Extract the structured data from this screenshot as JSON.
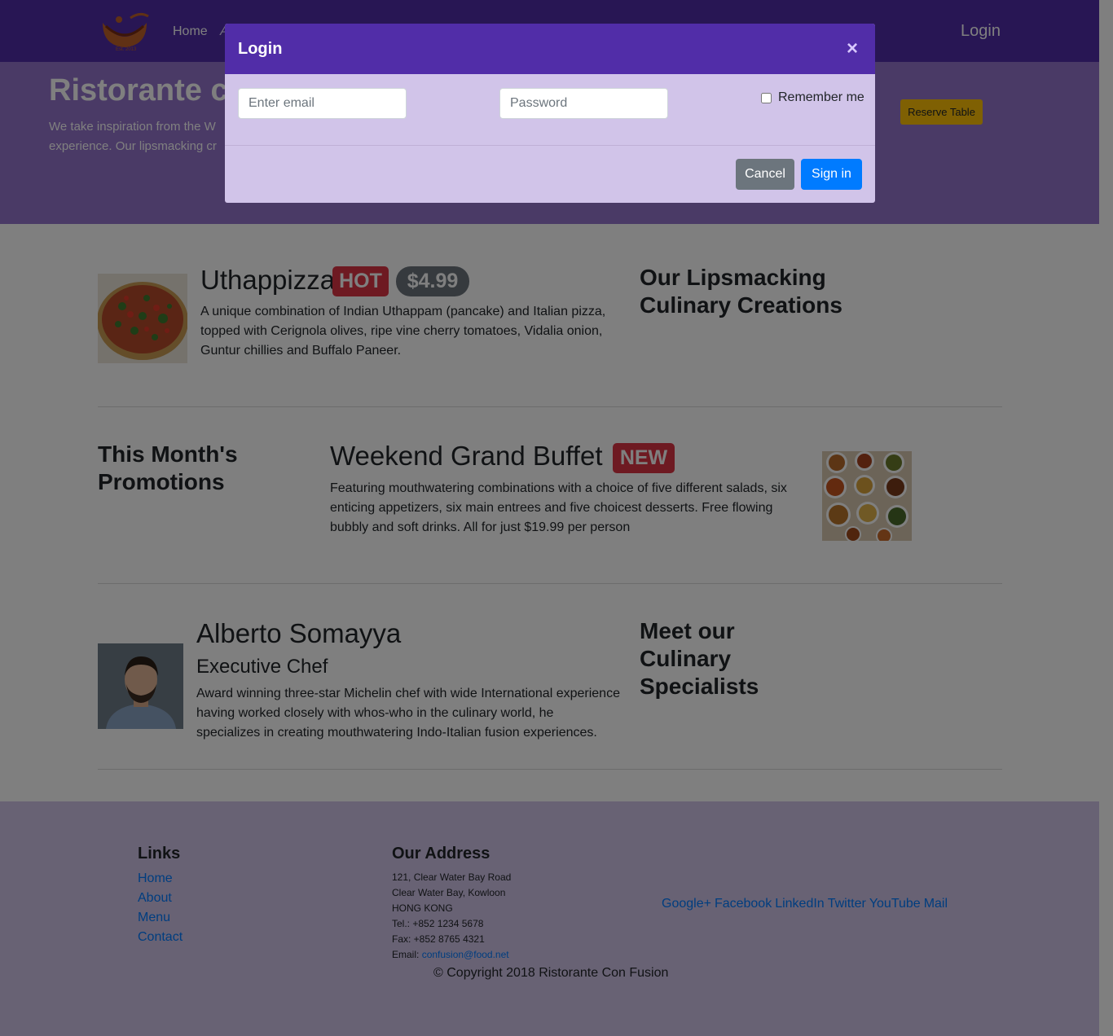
{
  "navbar": {
    "home_label": "Home",
    "about_label": "A",
    "login_label": "Login"
  },
  "jumbotron": {
    "title": "Ristorante c",
    "text_line1": "We take inspiration from the W",
    "text_line2": "experience. Our lipsmacking cr",
    "reserve_label": "Reserve Table"
  },
  "dish": {
    "name": "Uthappizza",
    "badge": "HOT",
    "price": "$4.99",
    "description": "A unique combination of Indian Uthappam (pancake) and Italian pizza, topped with Cerignola olives, ripe vine cherry tomatoes, Vidalia onion, Guntur chillies and Buffalo Paneer.",
    "section_title": "Our Lipsmacking Culinary Creations"
  },
  "promotion": {
    "section_title": "This Month's Promotions",
    "name": "Weekend Grand Buffet",
    "badge": "NEW",
    "description": "Featuring mouthwatering combinations with a choice of five different salads, six enticing appetizers, six main entrees and five choicest desserts. Free flowing bubbly and soft drinks. All for just $19.99 per person"
  },
  "leader": {
    "name": "Alberto Somayya",
    "designation": "Executive Chef",
    "description": "Award winning three-star Michelin chef with wide International experience having worked closely with whos-who in the culinary world, he specializes in creating mouthwatering Indo-Italian fusion experiences.",
    "section_title": "Meet our Culinary Specialists"
  },
  "footer": {
    "links_heading": "Links",
    "links": [
      "Home",
      "About",
      "Menu",
      "Contact"
    ],
    "address_heading": "Our Address",
    "address_lines": [
      "121, Clear Water Bay Road",
      "Clear Water Bay, Kowloon",
      "HONG KONG",
      "Tel.: +852 1234 5678",
      "Fax: +852 8765 4321"
    ],
    "email_label": "Email: ",
    "email": "confusion@food.net",
    "social": [
      "Google+",
      "Facebook",
      "LinkedIn",
      "Twitter",
      "YouTube",
      "Mail"
    ],
    "copyright": "© Copyright 2018 Ristorante Con Fusion"
  },
  "modal": {
    "title": "Login",
    "close": "×",
    "email_placeholder": "Enter email",
    "password_placeholder": "Password",
    "remember_label": "Remember me",
    "cancel_label": "Cancel",
    "signin_label": "Sign in"
  },
  "colors": {
    "primary": "#512da8",
    "primary_light": "#9575cd",
    "primary_pale": "#d1c4e9",
    "danger": "#dc3545",
    "secondary": "#6c757d",
    "link": "#007bff",
    "warning": "#ffc107"
  }
}
